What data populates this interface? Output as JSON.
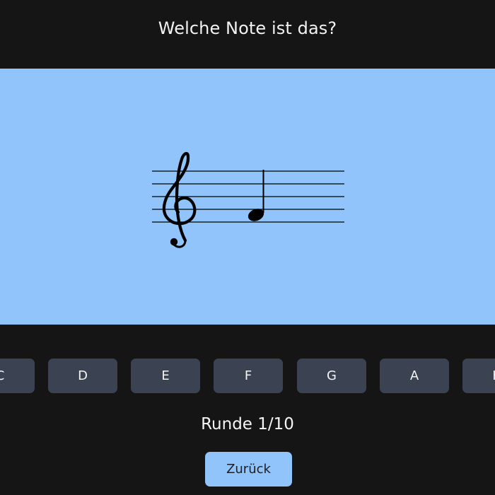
{
  "question": "Welche Note ist das?",
  "staff": {
    "clef": "treble-clef",
    "clef_glyph": "𝄞",
    "note": "quarter-note"
  },
  "answers": [
    "C",
    "D",
    "E",
    "F",
    "G",
    "A",
    "H"
  ],
  "round_label": "Runde 1/10",
  "back_label": "Zurück",
  "colors": {
    "background": "#151515",
    "staff_panel": "#90c4fb",
    "answer_button": "#3b4353",
    "back_button": "#90c4fb",
    "staff_ink": "#000000",
    "text": "#f2f2f2"
  }
}
